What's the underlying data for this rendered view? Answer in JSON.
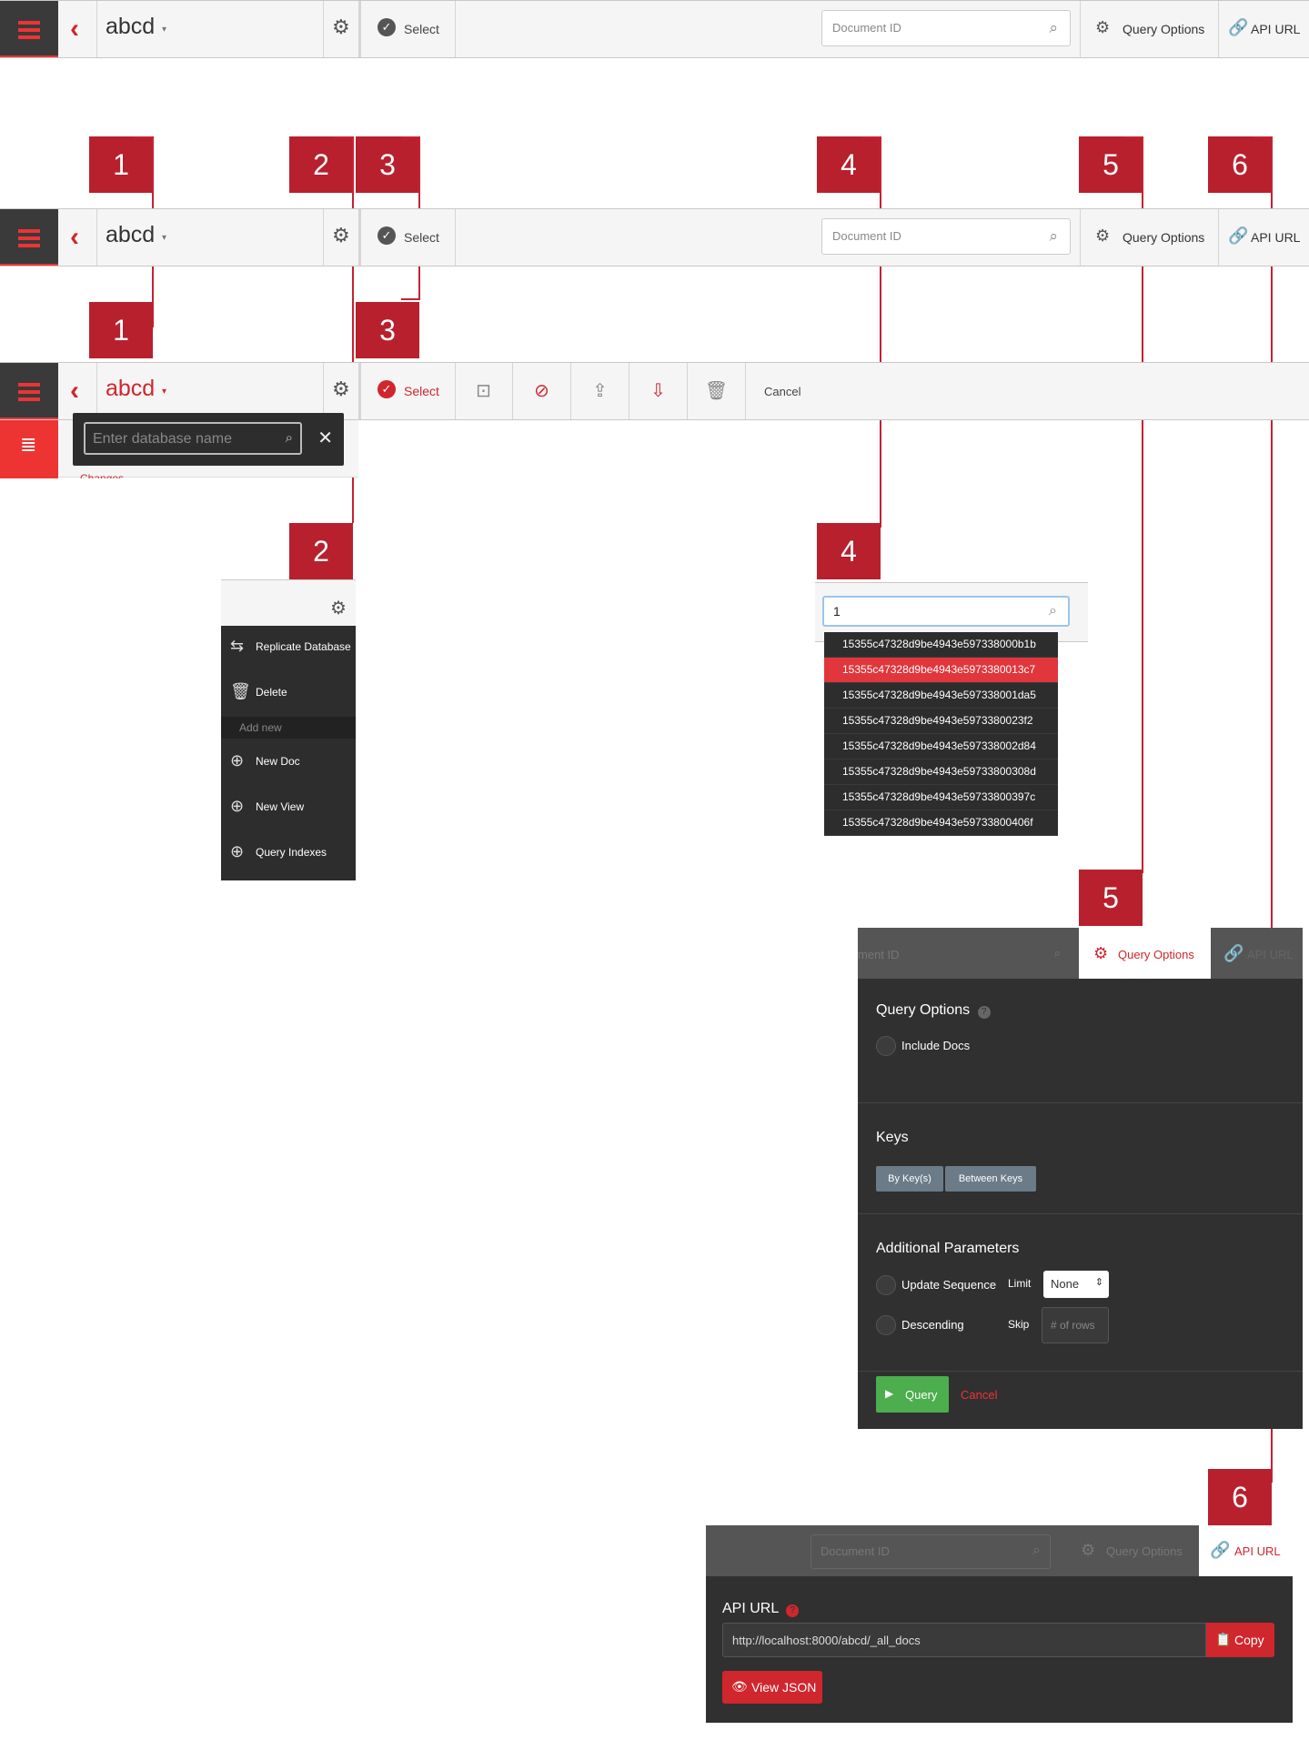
{
  "header": {
    "db_name": "abcd",
    "caret": "▾",
    "select_label": "Select",
    "search_placeholder": "Document ID",
    "query_options_label": "Query Options",
    "api_url_label": "API URL",
    "cancel_label": "Cancel"
  },
  "markers": [
    "1",
    "2",
    "3",
    "4",
    "5",
    "6"
  ],
  "db_search": {
    "placeholder": "Enter database name",
    "behind_text": "Changes"
  },
  "gear_menu": {
    "items": [
      "Replicate Database",
      "Delete"
    ],
    "section_header": "Add new",
    "add_items": [
      "New Doc",
      "New View",
      "Query Indexes"
    ]
  },
  "doc_search": {
    "typed_value": "1",
    "results": [
      "15355c47328d9be4943e597338000b1b",
      "15355c47328d9be4943e5973380013c7",
      "15355c47328d9be4943e597338001da5",
      "15355c47328d9be4943e5973380023f2",
      "15355c47328d9be4943e597338002d84",
      "15355c47328d9be4943e59733800308d",
      "15355c47328d9be4943e59733800397c",
      "15355c47328d9be4943e59733800406f"
    ],
    "highlighted_index": 1
  },
  "query_options": {
    "header_fragment": "ment ID",
    "api_fragment": "API URL",
    "title": "Query Options",
    "include_docs": "Include Docs",
    "keys_title": "Keys",
    "by_keys": "By Key(s)",
    "between_keys": "Between Keys",
    "additional_title": "Additional Parameters",
    "update_sequence": "Update Sequence",
    "limit_label": "Limit",
    "limit_value": "None",
    "descending": "Descending",
    "skip_label": "Skip",
    "skip_placeholder": "# of rows",
    "query_button": "Query",
    "cancel": "Cancel"
  },
  "api_panel": {
    "title": "API URL",
    "url": "http://localhost:8000/abcd/_all_docs",
    "copy_button": "Copy",
    "view_json_button": "View JSON"
  },
  "colors": {
    "accent": "#d0262e",
    "marker": "#b8202e",
    "dark_panel": "#303030",
    "toolbar": "#f5f5f5",
    "success": "#4cae4c"
  }
}
